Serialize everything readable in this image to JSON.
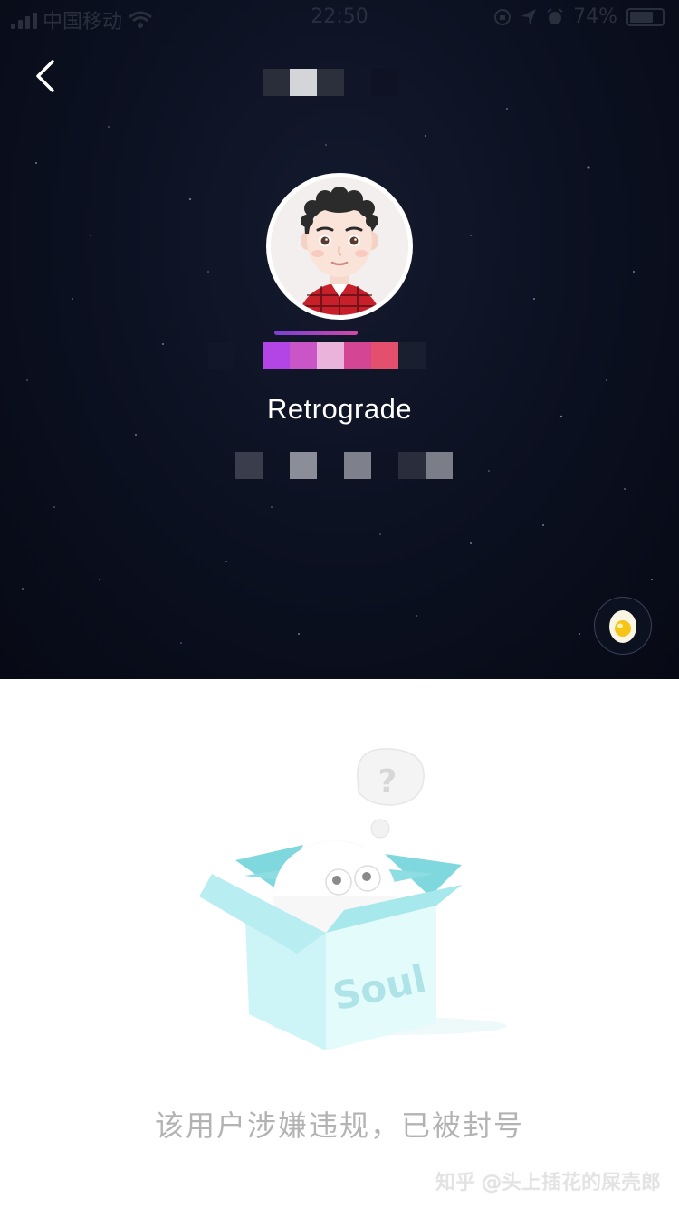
{
  "status_bar": {
    "carrier": "中国移动",
    "time": "22:50",
    "battery": "74%"
  },
  "nav": {
    "back_icon": "chevron-left-icon"
  },
  "profile": {
    "username": "Retrograde",
    "egg_icon": "egg-icon"
  },
  "illustration": {
    "box_label": "Soul",
    "bubble_text": "?"
  },
  "message": "该用户涉嫌违规，已被封号",
  "watermark": "知乎 @头上插花的屎壳郎",
  "colors": {
    "hero_bg": "#0b1020",
    "box_teal": "#b9eef0",
    "message_gray": "#b3b3b3"
  }
}
